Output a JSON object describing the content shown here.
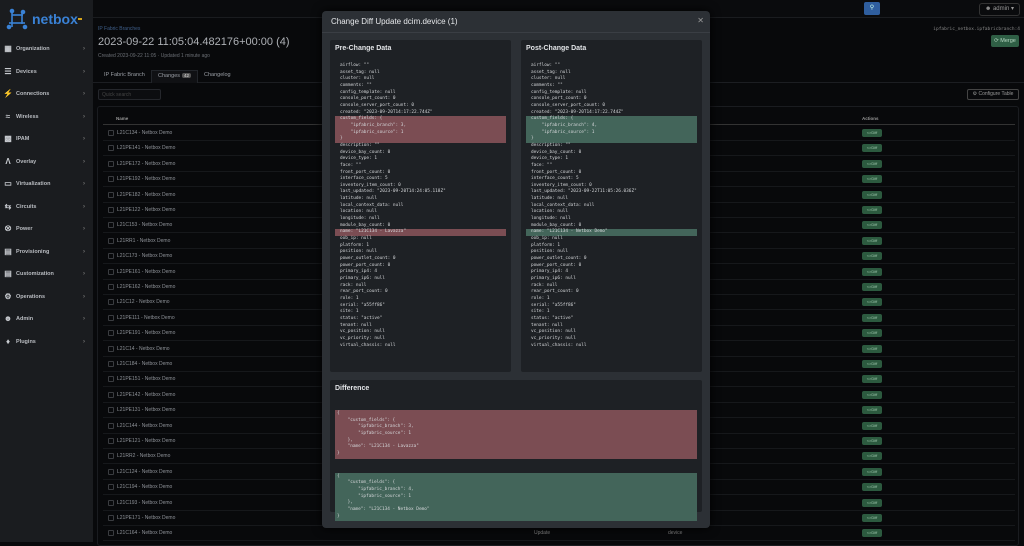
{
  "app": {
    "logo": "netbox"
  },
  "sidebar": {
    "items": [
      {
        "label": "Organization",
        "icon": "building-icon"
      },
      {
        "label": "Devices",
        "icon": "server-icon"
      },
      {
        "label": "Connections",
        "icon": "plug-icon"
      },
      {
        "label": "Wireless",
        "icon": "wifi-icon"
      },
      {
        "label": "IPAM",
        "icon": "ip-icon"
      },
      {
        "label": "Overlay",
        "icon": "overlay-icon"
      },
      {
        "label": "Virtualization",
        "icon": "monitor-icon"
      },
      {
        "label": "Circuits",
        "icon": "circuits-icon"
      },
      {
        "label": "Power",
        "icon": "power-icon"
      },
      {
        "label": "Provisioning",
        "icon": "file-icon"
      },
      {
        "label": "Customization",
        "icon": "toolbox-icon"
      },
      {
        "label": "Operations",
        "icon": "gears-icon"
      },
      {
        "label": "Admin",
        "icon": "users-icon"
      },
      {
        "label": "Plugins",
        "icon": "puzzle-icon"
      }
    ]
  },
  "topbar": {
    "user": "admin"
  },
  "page": {
    "breadcrumb": "IP Fabric Branches",
    "title": "2023-09-22 11:05:04.482176+00:00 (4)",
    "subtitle": "Created 2023-09-22 11:05 · Updated 1 minute ago",
    "ref": "ipfabric_netbox.ipfabricbranch:4",
    "merge": "Merge",
    "tabs": [
      {
        "label": "IP Fabric Branch"
      },
      {
        "label": "Changes",
        "count": "42"
      },
      {
        "label": "Changelog"
      }
    ],
    "quick_search_placeholder": "Quick search",
    "configure_table": "Configure Table"
  },
  "table": {
    "headers": {
      "name": "Name",
      "actions": "Actions"
    },
    "diff_label": "<>Diff",
    "rows": [
      "L21C134 - Netbox Demo",
      "L21PE141 - Netbox Demo",
      "L21PE172 - Netbox Demo",
      "L21PE192 - Netbox Demo",
      "L21PE182 - Netbox Demo",
      "L21PE122 - Netbox Demo",
      "L21C153 - Netbox Demo",
      "L21RR1 - Netbox Demo",
      "L21C173 - Netbox Demo",
      "L21PE161 - Netbox Demo",
      "L21PE162 - Netbox Demo",
      "L21C12 - Netbox Demo",
      "L21PE111 - Netbox Demo",
      "L21PE191 - Netbox Demo",
      "L21C14 - Netbox Demo",
      "L21C184 - Netbox Demo",
      "L21PE151 - Netbox Demo",
      "L21PE142 - Netbox Demo",
      "L21PE131 - Netbox Demo",
      "L21C144 - Netbox Demo",
      "L21PE121 - Netbox Demo",
      "L21RR2 - Netbox Demo",
      "L21C124 - Netbox Demo",
      "L21C194 - Netbox Demo",
      "L21C193 - Netbox Demo",
      "L21PE171 - Netbox Demo",
      "L21C164 - Netbox Demo"
    ],
    "last_row_action": "Update",
    "last_row_type": "device"
  },
  "modal": {
    "title": "Change Diff Update dcim.device (1)",
    "pre_title": "Pre-Change Data",
    "post_title": "Post-Change Data",
    "diff_title": "Difference",
    "pre": [
      [
        "airflow: \"\"",
        ""
      ],
      [
        "asset_tag: null",
        ""
      ],
      [
        "cluster: null",
        ""
      ],
      [
        "comments: \"\"",
        ""
      ],
      [
        "config_template: null",
        ""
      ],
      [
        "console_port_count: 0",
        ""
      ],
      [
        "console_server_port_count: 0",
        ""
      ],
      [
        "created: \"2023-09-20T14:17:22.744Z\"",
        ""
      ],
      [
        "custom_fields: {",
        "del"
      ],
      [
        "    \"ipfabric_branch\": 3,",
        "del"
      ],
      [
        "    \"ipfabric_source\": 1",
        "del"
      ],
      [
        "}",
        "del"
      ],
      [
        "description: \"\"",
        ""
      ],
      [
        "device_bay_count: 0",
        ""
      ],
      [
        "device_type: 1",
        ""
      ],
      [
        "face: \"\"",
        ""
      ],
      [
        "front_port_count: 0",
        ""
      ],
      [
        "interface_count: 5",
        ""
      ],
      [
        "inventory_item_count: 0",
        ""
      ],
      [
        "last_updated: \"2023-09-20T14:24:05.118Z\"",
        ""
      ],
      [
        "latitude: null",
        ""
      ],
      [
        "local_context_data: null",
        ""
      ],
      [
        "location: null",
        ""
      ],
      [
        "longitude: null",
        ""
      ],
      [
        "module_bay_count: 0",
        ""
      ],
      [
        "name: \"L21C134 - Lavazza\"",
        "del"
      ],
      [
        "oob_ip: null",
        ""
      ],
      [
        "platform: 1",
        ""
      ],
      [
        "position: null",
        ""
      ],
      [
        "power_outlet_count: 0",
        ""
      ],
      [
        "power_port_count: 0",
        ""
      ],
      [
        "primary_ip4: 4",
        ""
      ],
      [
        "primary_ip6: null",
        ""
      ],
      [
        "rack: null",
        ""
      ],
      [
        "rear_port_count: 0",
        ""
      ],
      [
        "role: 1",
        ""
      ],
      [
        "serial: \"a55ff86\"",
        ""
      ],
      [
        "site: 1",
        ""
      ],
      [
        "status: \"active\"",
        ""
      ],
      [
        "tenant: null",
        ""
      ],
      [
        "vc_position: null",
        ""
      ],
      [
        "vc_priority: null",
        ""
      ],
      [
        "virtual_chassis: null",
        ""
      ]
    ],
    "post": [
      [
        "airflow: \"\"",
        ""
      ],
      [
        "asset_tag: null",
        ""
      ],
      [
        "cluster: null",
        ""
      ],
      [
        "comments: \"\"",
        ""
      ],
      [
        "config_template: null",
        ""
      ],
      [
        "console_port_count: 0",
        ""
      ],
      [
        "console_server_port_count: 0",
        ""
      ],
      [
        "created: \"2023-09-20T14:17:22.744Z\"",
        ""
      ],
      [
        "custom_fields: {",
        "add"
      ],
      [
        "    \"ipfabric_branch\": 4,",
        "add"
      ],
      [
        "    \"ipfabric_source\": 1",
        "add"
      ],
      [
        "}",
        "add"
      ],
      [
        "description: \"\"",
        ""
      ],
      [
        "device_bay_count: 0",
        ""
      ],
      [
        "device_type: 1",
        ""
      ],
      [
        "face: \"\"",
        ""
      ],
      [
        "front_port_count: 0",
        ""
      ],
      [
        "interface_count: 5",
        ""
      ],
      [
        "inventory_item_count: 0",
        ""
      ],
      [
        "last_updated: \"2023-09-22T11:05:26.036Z\"",
        ""
      ],
      [
        "latitude: null",
        ""
      ],
      [
        "local_context_data: null",
        ""
      ],
      [
        "location: null",
        ""
      ],
      [
        "longitude: null",
        ""
      ],
      [
        "module_bay_count: 0",
        ""
      ],
      [
        "name: \"L21C134 - Netbox Demo\"",
        "add"
      ],
      [
        "oob_ip: null",
        ""
      ],
      [
        "platform: 1",
        ""
      ],
      [
        "position: null",
        ""
      ],
      [
        "power_outlet_count: 0",
        ""
      ],
      [
        "power_port_count: 0",
        ""
      ],
      [
        "primary_ip4: 4",
        ""
      ],
      [
        "primary_ip6: null",
        ""
      ],
      [
        "rack: null",
        ""
      ],
      [
        "rear_port_count: 0",
        ""
      ],
      [
        "role: 1",
        ""
      ],
      [
        "serial: \"a55ff86\"",
        ""
      ],
      [
        "site: 1",
        ""
      ],
      [
        "status: \"active\"",
        ""
      ],
      [
        "tenant: null",
        ""
      ],
      [
        "vc_position: null",
        ""
      ],
      [
        "vc_priority: null",
        ""
      ],
      [
        "virtual_chassis: null",
        ""
      ]
    ],
    "diff_removed": [
      "{",
      "    \"custom_fields\": {",
      "        \"ipfabric_branch\": 3,",
      "        \"ipfabric_source\": 1",
      "    },",
      "    \"name\": \"L21C134 - Lavazza\"",
      "}"
    ],
    "diff_added": [
      "{",
      "    \"custom_fields\": {",
      "        \"ipfabric_branch\": 4,",
      "        \"ipfabric_source\": 1",
      "    },",
      "    \"name\": \"L21C134 - Netbox Demo\"",
      "}"
    ]
  },
  "colors": {
    "removed": "#7b4d53",
    "added": "#43655a",
    "accent": "#3a82d6"
  }
}
